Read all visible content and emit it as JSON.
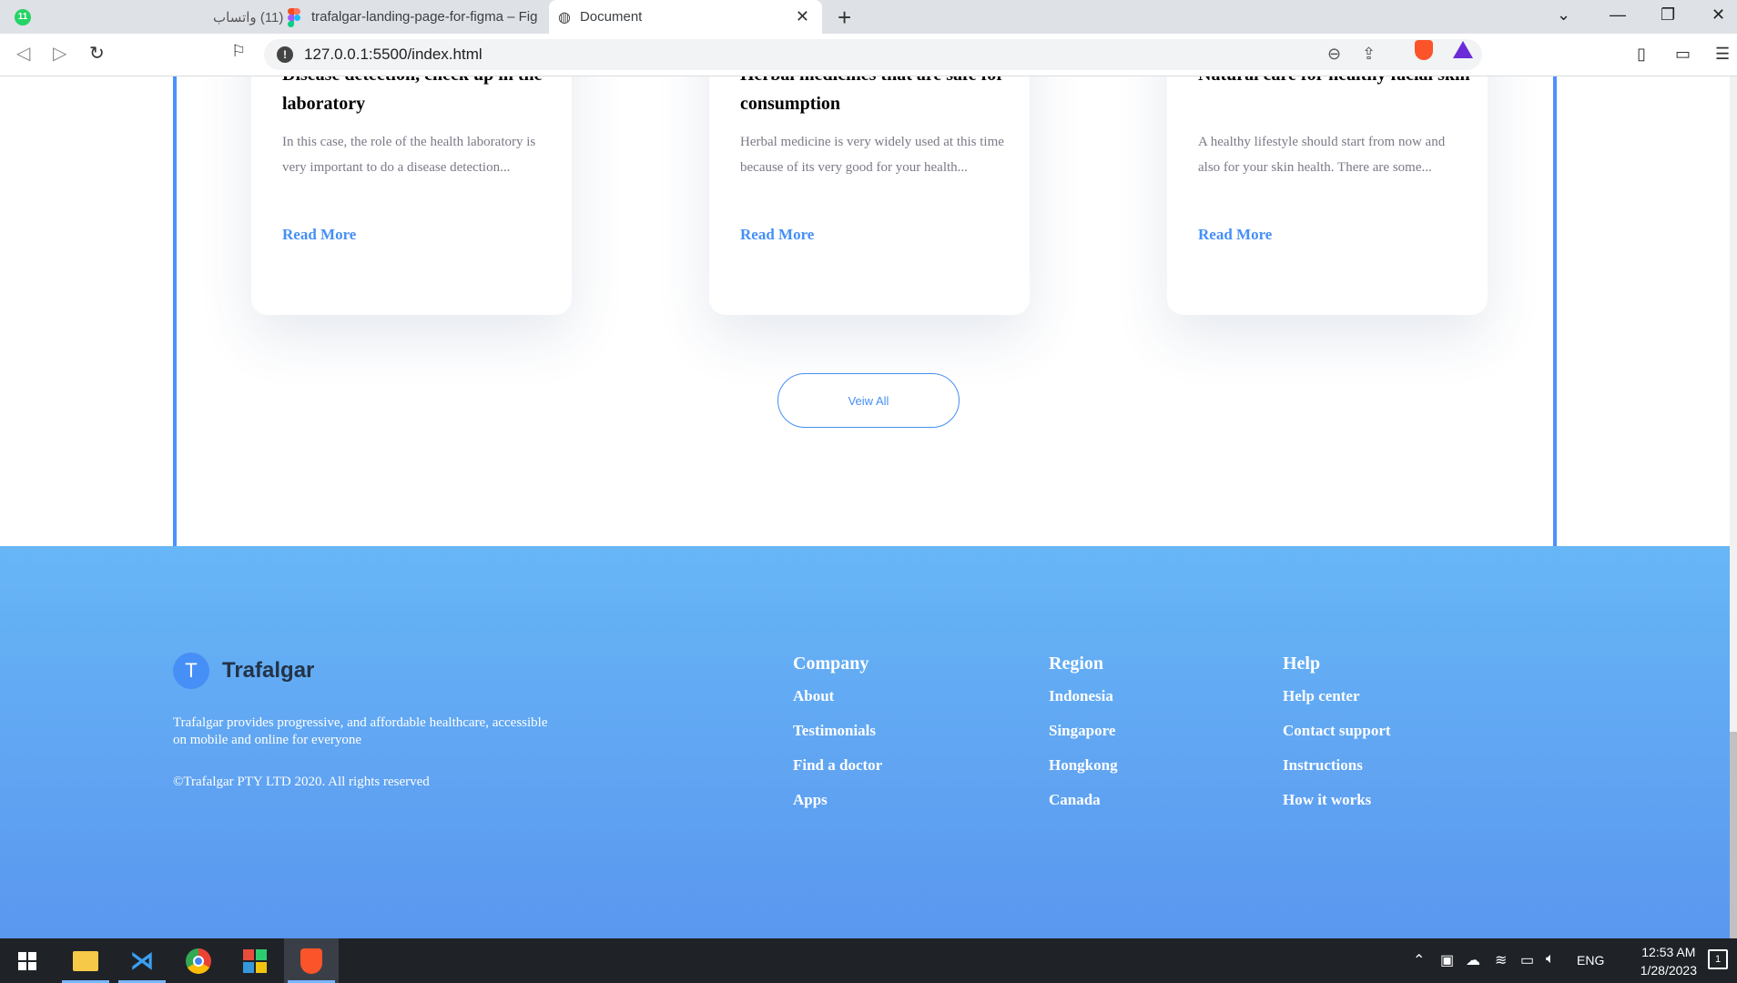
{
  "browser": {
    "tabs": [
      {
        "label": "(11) واتساب",
        "badge": "11"
      },
      {
        "label": "trafalgar-landing-page-for-figma – Fig"
      },
      {
        "label": "Document"
      }
    ],
    "url": "127.0.0.1:5500/index.html"
  },
  "cards": [
    {
      "title": "Disease detection, check up in the laboratory",
      "text": "In this case, the role of the health laboratory is very important to do a disease detection...",
      "link": "Read More"
    },
    {
      "title": "Herbal medicines that are safe for consumption",
      "text": "Herbal medicine is very widely used at this time because of its very good for your health...",
      "link": "Read More"
    },
    {
      "title": "Natural care for healthy facial skin",
      "text": "A healthy lifestyle should start from now and also for your skin health. There are some...",
      "link": "Read More"
    }
  ],
  "view_all_label": "Veiw All",
  "footer": {
    "logo_letter": "T",
    "brand": "Trafalgar",
    "description": "Trafalgar provides progressive, and affordable healthcare, accessible on mobile and online for everyone",
    "copyright": "©Trafalgar PTY LTD 2020. All rights reserved",
    "columns": [
      {
        "heading": "Company",
        "links": [
          "About",
          "Testimonials",
          "Find a doctor",
          "Apps"
        ]
      },
      {
        "heading": "Region",
        "links": [
          "Indonesia",
          "Singapore",
          "Hongkong",
          "Canada"
        ]
      },
      {
        "heading": "Help",
        "links": [
          "Help center",
          "Contact support",
          "Instructions",
          "How it works"
        ]
      }
    ]
  },
  "taskbar": {
    "language": "ENG",
    "time": "12:53 AM",
    "date": "1/28/2023",
    "notification_count": "1"
  }
}
